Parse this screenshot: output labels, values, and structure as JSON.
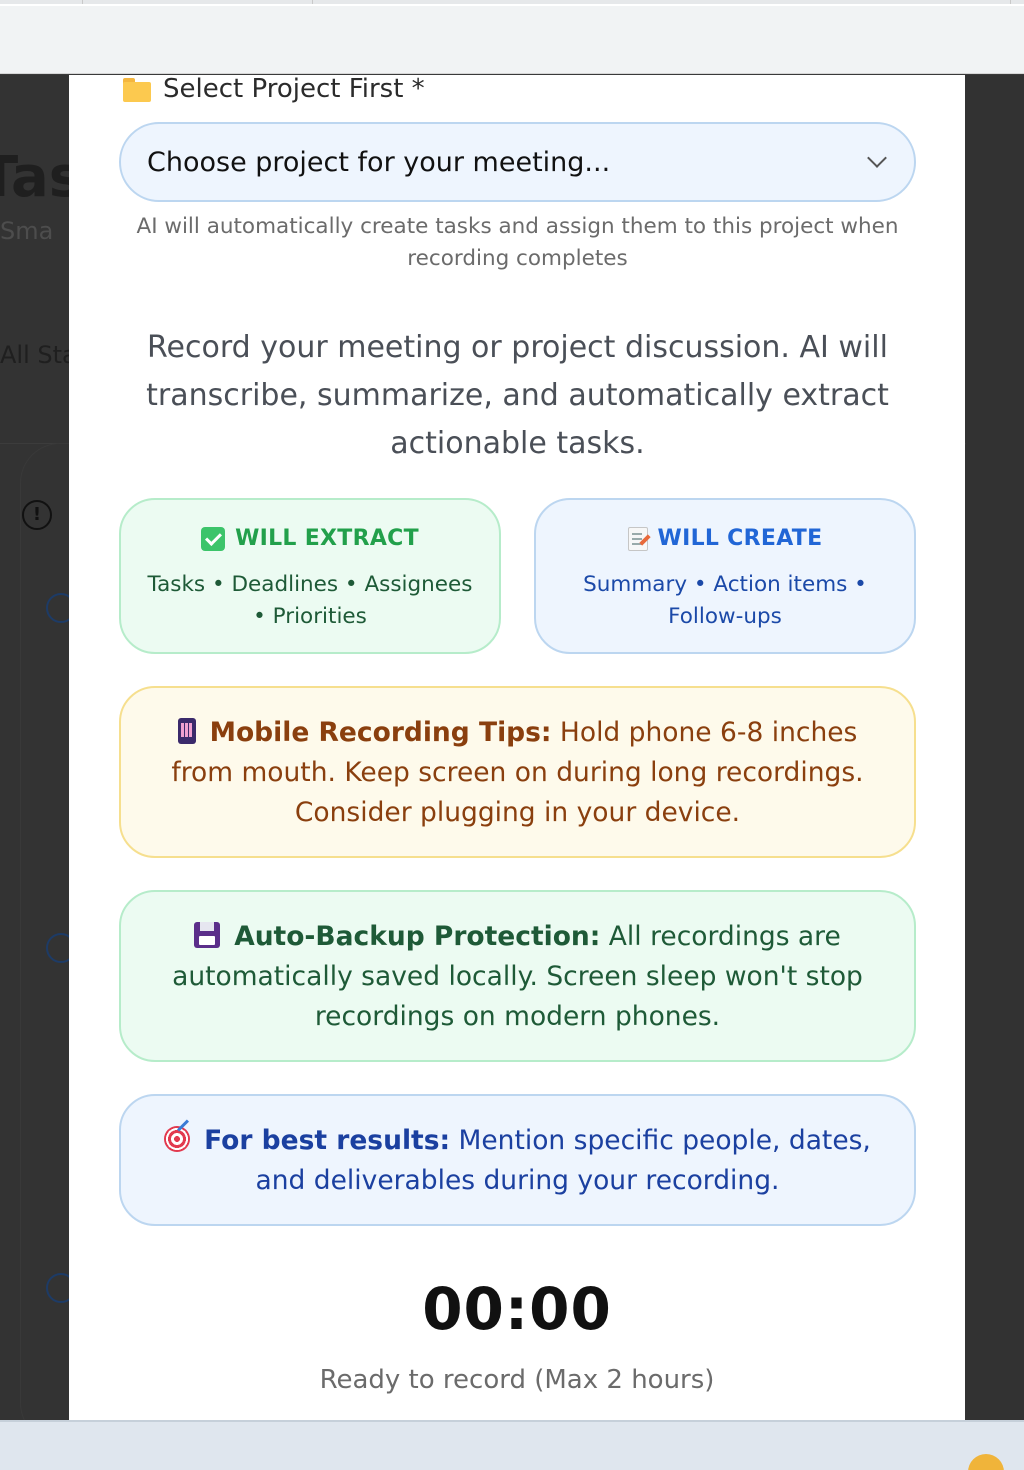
{
  "modal": {
    "project_label": "Select Project First *",
    "project_select": {
      "value": "Choose project for your meeting..."
    },
    "helper_text": "AI will automatically create tasks and assign them to this project when recording completes",
    "intro_text": "Record your meeting or project discussion. AI will transcribe, summarize, and automatically extract actionable tasks.",
    "will_extract": {
      "title": "WILL EXTRACT",
      "body": "Tasks • Deadlines • Assignees • Priorities"
    },
    "will_create": {
      "title": "WILL CREATE",
      "body": "Summary • Action items • Follow-ups"
    },
    "mobile_tip": {
      "title": "Mobile Recording Tips:",
      "body": " Hold phone 6-8 inches from mouth. Keep screen on during long recordings. Consider plugging in your device."
    },
    "backup_tip": {
      "title": "Auto-Backup Protection:",
      "body": " All recordings are automatically saved locally. Screen sleep won't stop recordings on modern phones."
    },
    "best_tip": {
      "title": "For best results:",
      "body": " Mention specific people, dates, and deliverables during your recording."
    },
    "timer": "00:00",
    "status": "Ready to record (Max 2 hours)"
  },
  "background": {
    "title_fragment": "Tas",
    "subtitle_fragment": "Sma",
    "filter_fragment": "All Sta",
    "info_icon_glyph": "!"
  },
  "colors": {
    "extract_accent": "#22a04b",
    "create_accent": "#2166d6",
    "mobile_tip_text": "#8a3f0e",
    "backup_tip_text": "#1e5a37",
    "best_tip_text": "#1b40a0"
  },
  "icons": {
    "project_label": "folder-icon",
    "will_extract": "check-icon",
    "will_create": "memo-icon",
    "mobile_tip": "phone-icon",
    "backup_tip": "floppy-disk-icon",
    "best_tip": "target-icon",
    "select": "chevron-down-icon"
  }
}
